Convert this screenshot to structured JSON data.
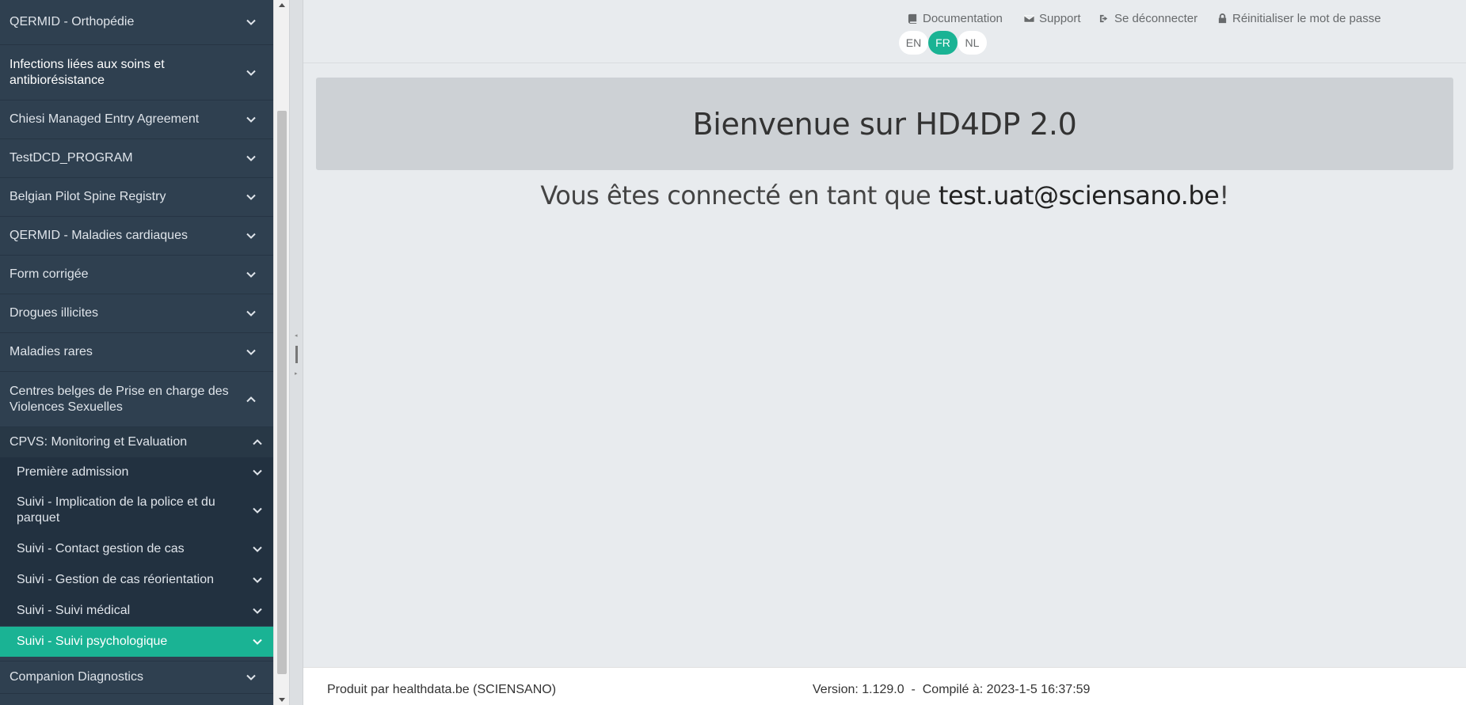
{
  "sidebar": {
    "items": [
      {
        "label": "QERMID - Orthopédie"
      },
      {
        "label": "Infections liées aux soins et antibiorésistance"
      },
      {
        "label": "Chiesi Managed Entry Agreement"
      },
      {
        "label": "TestDCD_PROGRAM"
      },
      {
        "label": "Belgian Pilot Spine Registry"
      },
      {
        "label": "QERMID - Maladies cardiaques"
      },
      {
        "label": "Form corrigée"
      },
      {
        "label": "Drogues illicites"
      },
      {
        "label": "Maladies rares"
      },
      {
        "label": "Centres belges de Prise en charge des Violences Sexuelles"
      },
      {
        "label": "Companion Diagnostics"
      }
    ],
    "sub": {
      "label": "CPVS: Monitoring et Evaluation"
    },
    "sub_items": [
      {
        "label": "Première admission"
      },
      {
        "label": "Suivi - Implication de la police et du parquet"
      },
      {
        "label": "Suivi - Contact gestion de cas"
      },
      {
        "label": "Suivi - Gestion de cas réorientation"
      },
      {
        "label": "Suivi - Suivi médical"
      },
      {
        "label": "Suivi - Suivi psychologique"
      }
    ]
  },
  "topbar": {
    "documentation": "Documentation",
    "support": "Support",
    "logout": "Se déconnecter",
    "reset_password": "Réinitialiser le mot de passe",
    "languages": [
      "EN",
      "FR",
      "NL"
    ],
    "active_language": "FR"
  },
  "main": {
    "welcome": "Bienvenue sur HD4DP 2.0",
    "connected_prefix": "Vous êtes connecté en tant que ",
    "user": "test.uat@sciensano.be",
    "connected_suffix": "!"
  },
  "footer": {
    "produced_by": "Produit par healthdata.be (SCIENSANO)",
    "version": "Version: 1.129.0  -  Compilé à: 2023-1-5 16:37:59"
  },
  "colors": {
    "sidebar_bg": "#2f4050",
    "accent": "#1ab394"
  }
}
